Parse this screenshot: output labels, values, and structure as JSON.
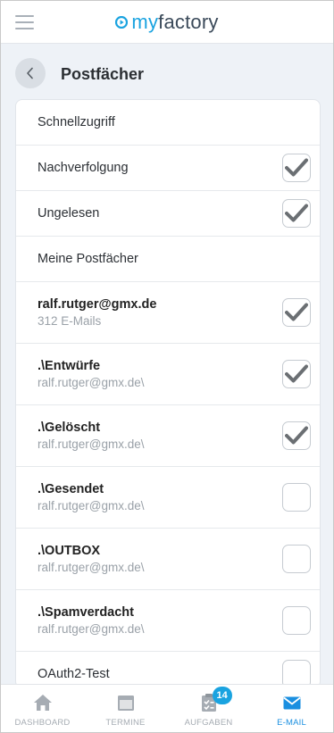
{
  "header": {
    "logo_text": "myfactory",
    "logo_prefix": "my",
    "logo_suffix": "factory"
  },
  "page": {
    "title": "Postfächer"
  },
  "rows": [
    {
      "type": "single",
      "label": "Schnellzugriff",
      "checkbox": null
    },
    {
      "type": "single",
      "label": "Nachverfolgung",
      "checkbox": true
    },
    {
      "type": "single",
      "label": "Ungelesen",
      "checkbox": true
    },
    {
      "type": "single",
      "label": "Meine Postfächer",
      "checkbox": null
    },
    {
      "type": "double",
      "title": "ralf.rutger@gmx.de",
      "subtitle": "312 E-Mails",
      "checkbox": true
    },
    {
      "type": "double",
      "title": ".\\Entwürfe",
      "subtitle": "ralf.rutger@gmx.de\\",
      "checkbox": true
    },
    {
      "type": "double",
      "title": ".\\Gelöscht",
      "subtitle": "ralf.rutger@gmx.de\\",
      "checkbox": true
    },
    {
      "type": "double",
      "title": ".\\Gesendet",
      "subtitle": "ralf.rutger@gmx.de\\",
      "checkbox": false
    },
    {
      "type": "double",
      "title": ".\\OUTBOX",
      "subtitle": "ralf.rutger@gmx.de\\",
      "checkbox": false
    },
    {
      "type": "double",
      "title": ".\\Spamverdacht",
      "subtitle": "ralf.rutger@gmx.de\\",
      "checkbox": false
    },
    {
      "type": "single",
      "label": "OAuth2-Test",
      "checkbox": false
    }
  ],
  "nav": {
    "items": [
      {
        "label": "DASHBOARD",
        "icon": "home-icon",
        "active": false
      },
      {
        "label": "TERMINE",
        "icon": "calendar-icon",
        "active": false
      },
      {
        "label": "AUFGABEN",
        "icon": "tasks-icon",
        "active": false,
        "badge": "14"
      },
      {
        "label": "E-MAIL",
        "icon": "mail-icon",
        "active": true
      }
    ]
  },
  "colors": {
    "accent": "#1aa3e0",
    "active_nav": "#1a8fe0",
    "check": "#6b6f73",
    "inactive_icon": "#a6acb3"
  }
}
